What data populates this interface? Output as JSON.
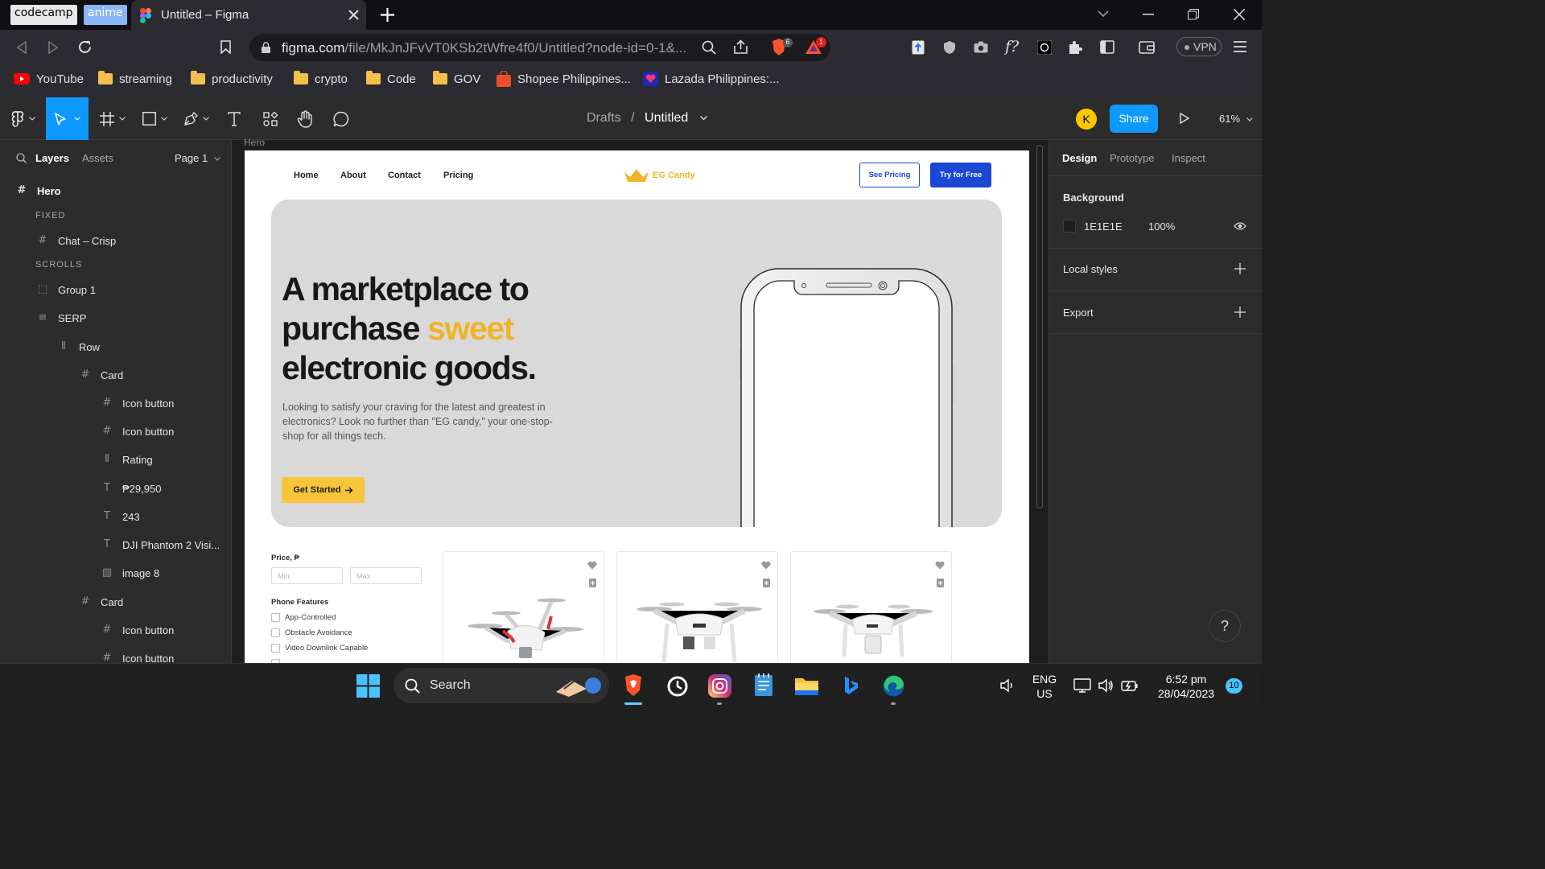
{
  "browser": {
    "tabs": [
      {
        "label": "codecamp"
      },
      {
        "label": "anime"
      },
      {
        "label": "Untitled – Figma",
        "active": true
      }
    ],
    "url_domain": "figma.com",
    "url_path": "/file/MkJnJFvVT0KSb2tWfre4f0/Untitled?node-id=0-1&...",
    "vpn_label": "VPN",
    "brave_badge": "6",
    "alert_badge": "1",
    "bookmarks": [
      {
        "label": "YouTube",
        "icon": "youtube-icon"
      },
      {
        "label": "streaming",
        "icon": "folder-icon"
      },
      {
        "label": "productivity",
        "icon": "folder-icon"
      },
      {
        "label": "crypto",
        "icon": "folder-icon"
      },
      {
        "label": "Code",
        "icon": "folder-icon"
      },
      {
        "label": "GOV",
        "icon": "folder-icon"
      },
      {
        "label": "Shopee Philippines...",
        "icon": "shopee-icon"
      },
      {
        "label": "Lazada Philippines:...",
        "icon": "lazada-icon"
      }
    ]
  },
  "figma": {
    "breadcrumb_parent": "Drafts",
    "breadcrumb_sep": "/",
    "file_name": "Untitled",
    "avatar_initial": "K",
    "share_label": "Share",
    "zoom": "61%",
    "left_tabs": {
      "layers": "Layers",
      "assets": "Assets",
      "page": "Page 1"
    },
    "layers": [
      {
        "name": "Hero",
        "icon": "frame-icon"
      },
      {
        "section": "FIXED"
      },
      {
        "name": "Chat – Crisp",
        "icon": "frame-icon"
      },
      {
        "section": "SCROLLS"
      },
      {
        "name": "Group 1",
        "icon": "group-icon"
      },
      {
        "name": "SERP",
        "icon": "autolayout-vertical-icon"
      },
      {
        "name": "Row",
        "icon": "autolayout-horizontal-icon"
      },
      {
        "name": "Card",
        "icon": "frame-icon"
      },
      {
        "name": "Icon button",
        "icon": "frame-icon"
      },
      {
        "name": "Icon button",
        "icon": "frame-icon"
      },
      {
        "name": "Rating",
        "icon": "autolayout-horizontal-icon"
      },
      {
        "name": "₱29,950",
        "icon": "text-icon"
      },
      {
        "name": "243",
        "icon": "text-icon"
      },
      {
        "name": "DJI Phantom 2 Visi...",
        "icon": "text-icon"
      },
      {
        "name": "image 8",
        "icon": "image-icon"
      },
      {
        "name": "Card",
        "icon": "frame-icon"
      },
      {
        "name": "Icon button",
        "icon": "frame-icon"
      },
      {
        "name": "Icon button",
        "icon": "frame-icon"
      }
    ],
    "right_tabs": {
      "design": "Design",
      "prototype": "Prototype",
      "inspect": "Inspect"
    },
    "background": {
      "label": "Background",
      "hex": "1E1E1E",
      "opacity": "100%"
    },
    "local_styles": "Local styles",
    "export": "Export",
    "help": "?",
    "accent_color": "#0d99ff"
  },
  "design": {
    "frame_label": "Hero",
    "nav": [
      "Home",
      "About",
      "Contact",
      "Pricing"
    ],
    "brand": "EG Candy",
    "see_pricing": "See Pricing",
    "try_free": "Try for Free",
    "headline_1": "A marketplace to",
    "headline_2": "purchase ",
    "headline_accent": "sweet",
    "headline_3": "electronic goods.",
    "subtext": "Looking to satisfy your craving for the latest and greatest in electronics? Look no further than \"EG candy,\" your one-stop-shop for all things tech.",
    "cta": "Get Started",
    "filter_price": "Price, ₱",
    "min_placeholder": "Min",
    "max_placeholder": "Max",
    "phone_features": "Phone Features",
    "features": [
      "App-Controlled",
      "Obstacle Avoidance",
      "Video Downlink Capable"
    ],
    "accent_yellow": "#f0b42b",
    "button_blue": "#1a47d4"
  },
  "taskbar": {
    "search": "Search",
    "lang_1": "ENG",
    "lang_2": "US",
    "time": "6:52 pm",
    "date": "28/04/2023",
    "notifications": "10"
  }
}
